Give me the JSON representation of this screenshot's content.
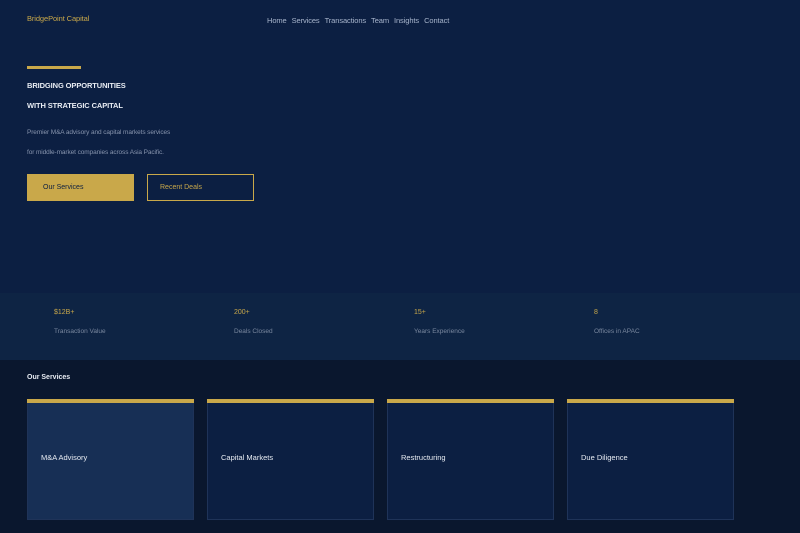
{
  "header": {
    "logo": "BridgePoint Capital",
    "nav": [
      "Home",
      "Services",
      "Transactions",
      "Team",
      "Insights",
      "Contact"
    ]
  },
  "hero": {
    "title_line1": "BRIDGING OPPORTUNITIES",
    "title_line2": "WITH STRATEGIC CAPITAL",
    "subtitle_line1": "Premier M&A advisory and capital markets services",
    "subtitle_line2": "for middle-market companies across Asia Pacific.",
    "primary_button": "Our Services",
    "secondary_button": "Recent Deals"
  },
  "stats": [
    {
      "value": "$12B+",
      "label": "Transaction Value"
    },
    {
      "value": "200+",
      "label": "Deals Closed"
    },
    {
      "value": "15+",
      "label": "Years Experience"
    },
    {
      "value": "8",
      "label": "Offices in APAC"
    }
  ],
  "services": {
    "heading": "Our Services",
    "cards": [
      {
        "title": "M&A Advisory"
      },
      {
        "title": "Capital Markets"
      },
      {
        "title": "Restructuring"
      },
      {
        "title": "Due Diligence"
      }
    ]
  },
  "colors": {
    "accent": "#c9a84a",
    "background": "#0c1f42",
    "stats_band": "#0e2444",
    "services_bg": "#0a172e"
  }
}
